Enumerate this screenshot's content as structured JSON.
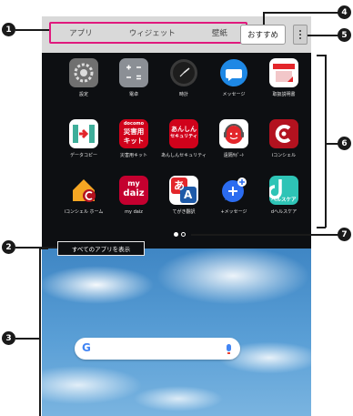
{
  "tabs": [
    "アプリ",
    "ウィジェット",
    "壁紙"
  ],
  "recommend_label": "おすすめ",
  "apps": [
    {
      "label": "設定",
      "icon": "gear-icon",
      "color": "#6d6d6d"
    },
    {
      "label": "電卓",
      "icon": "calculator-icon",
      "color": "#8b8f95"
    },
    {
      "label": "時計",
      "icon": "clock-icon",
      "color": "#2a2a2a"
    },
    {
      "label": "メッセージ",
      "icon": "message-icon",
      "color": "#1e88e5"
    },
    {
      "label": "取扱説明書",
      "icon": "manual-icon",
      "color": "#ffffff"
    },
    {
      "label": "データコピー",
      "icon": "data-copy-icon",
      "color": "#ffffff"
    },
    {
      "label": "災害用キット",
      "icon": "disaster-kit-icon",
      "color": "#d0021b"
    },
    {
      "label": "あんしんセキュリティ",
      "icon": "security-icon",
      "color": "#d0021b"
    },
    {
      "label": "遠隔ｻﾎﾟｰﾄ",
      "icon": "remote-support-icon",
      "color": "#ffffff"
    },
    {
      "label": "iコンシェル",
      "icon": "iconcier-icon",
      "color": "#b3121f"
    },
    {
      "label": "iコンシェル ホーム",
      "icon": "iconcier-home-icon",
      "color": "#f5a623"
    },
    {
      "label": "my daiz",
      "icon": "my-daiz-icon",
      "color": "#c4002f"
    },
    {
      "label": "てがき翻訳",
      "icon": "handwriting-translate-icon",
      "color": "#ffffff"
    },
    {
      "label": "+メッセージ",
      "icon": "plus-message-icon",
      "color": "#2b6cf0"
    },
    {
      "label": "dヘルスケア",
      "icon": "d-healthcare-icon",
      "color": "#2ec4b6"
    }
  ],
  "app_text": {
    "docomo": "docomo",
    "saigaiyou": "災害用",
    "kit": "キット",
    "anshin": "あんしん",
    "security": "セキュリティ",
    "my": "my",
    "daiz": "daiz",
    "a_hira": "あ",
    "a_latin": "A",
    "health": "ヘルスケア"
  },
  "show_all_label": "すべてのアプリを表示",
  "search": {
    "logo": "G"
  },
  "callouts": [
    "1",
    "2",
    "3",
    "4",
    "5",
    "6",
    "7"
  ],
  "colors": {
    "accent": "#e0197d",
    "callout": "#1a1a1a"
  }
}
